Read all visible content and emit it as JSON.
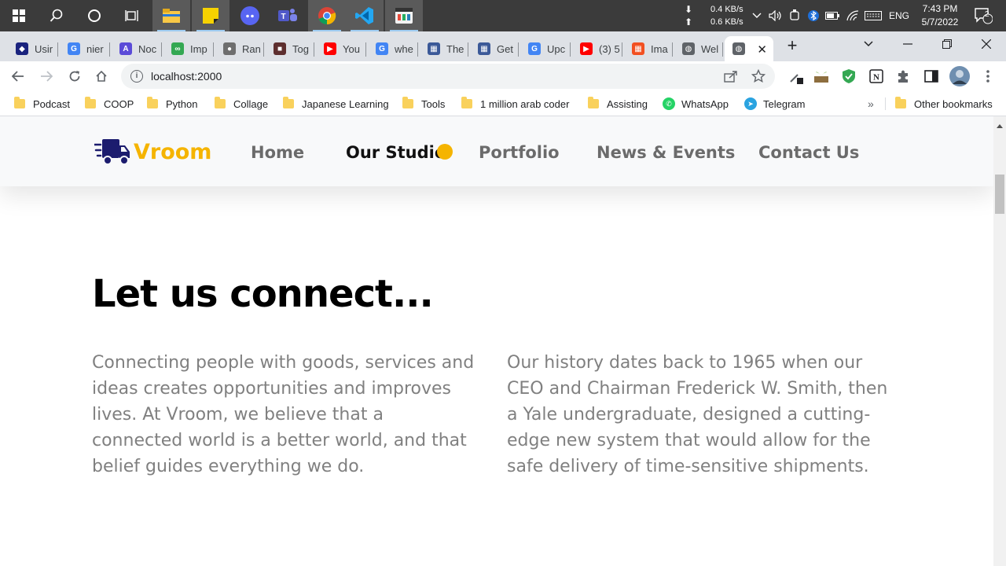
{
  "taskbar": {
    "net_down": "0.4 KB/s",
    "net_up": "0.6 KB/s",
    "language": "ENG",
    "time": "7:43 PM",
    "date": "5/7/2022",
    "notifications": "2"
  },
  "tabs": [
    {
      "label": "Usir",
      "color": "#1a237e",
      "glyph": "◆"
    },
    {
      "label": "nier",
      "color": "#4285f4",
      "glyph": "G"
    },
    {
      "label": "Noc",
      "color": "#5b4bd8",
      "glyph": "A"
    },
    {
      "label": "Imp",
      "color": "#34a853",
      "glyph": "∞"
    },
    {
      "label": "Ran",
      "color": "#6e6e6e",
      "glyph": "●"
    },
    {
      "label": "Tog",
      "color": "#5d2e2e",
      "glyph": "■"
    },
    {
      "label": "You",
      "color": "#ff0000",
      "glyph": "▶"
    },
    {
      "label": "whe",
      "color": "#4285f4",
      "glyph": "G"
    },
    {
      "label": "The",
      "color": "#3b5998",
      "glyph": "▦"
    },
    {
      "label": "Get",
      "color": "#3b5998",
      "glyph": "▦"
    },
    {
      "label": "Upc",
      "color": "#4285f4",
      "glyph": "G"
    },
    {
      "label": "(3) 5",
      "color": "#ff0000",
      "glyph": "▶"
    },
    {
      "label": "Ima",
      "color": "#f25022",
      "glyph": "▦"
    },
    {
      "label": "Wel",
      "color": "#5f6368",
      "glyph": "◍"
    },
    {
      "label": "",
      "color": "#5f6368",
      "glyph": "◍"
    }
  ],
  "address": {
    "url": "localhost:2000"
  },
  "bookmarks": [
    {
      "label": "Podcast"
    },
    {
      "label": "COOP"
    },
    {
      "label": "Python"
    },
    {
      "label": "Collage"
    },
    {
      "label": "Japanese Learning"
    },
    {
      "label": "Tools"
    },
    {
      "label": "1 million arab coder"
    },
    {
      "label": "Assisting"
    },
    {
      "label": "WhatsApp"
    },
    {
      "label": "Telegram"
    }
  ],
  "bookmarks_more": "»",
  "bookmarks_other": "Other bookmarks",
  "site": {
    "brand": "Vroom",
    "nav": [
      "Home",
      "Our Studio",
      "Portfolio",
      "News & Events",
      "Contact Us"
    ],
    "current_nav": "Our Studio",
    "heading": "Let us connect...",
    "paragraph_left": "Connecting people with goods, services and ideas creates opportunities and improves lives. At Vroom, we believe that a connected world is a better world, and that belief guides everything we do.",
    "paragraph_right": "Our history dates back to 1965 when our CEO and Chairman Frederick W. Smith, then a Yale undergraduate, designed a cutting-edge new system that would allow for the safe delivery of time-sensitive shipments."
  },
  "colors": {
    "brand_yellow": "#f5b400",
    "brand_navy": "#1c1c6e",
    "text_gray": "#808080"
  }
}
